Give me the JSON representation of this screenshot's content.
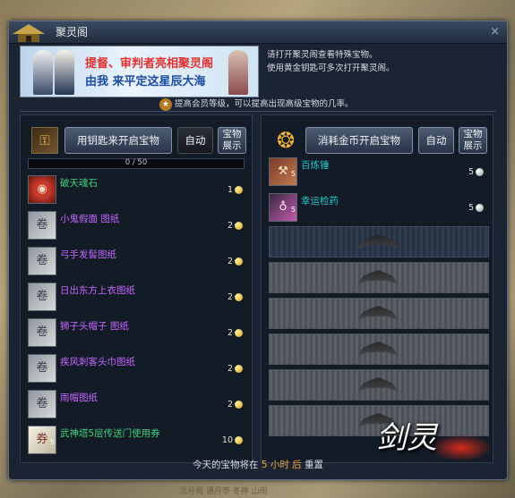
{
  "window": {
    "title": "聚灵阁",
    "close_symbol": "×"
  },
  "banner": {
    "line1": "提督、审判者亮相聚灵阁",
    "line2": "由我 来平定这星辰大海"
  },
  "notice": {
    "line1": "请打开聚灵阁查看特殊宝物。",
    "line2": "使用黄金钥匙可多次打开聚灵阁。"
  },
  "vip_hint": "提高会员等级，可以提高出现高级宝物的几率。",
  "left": {
    "open_button": "用钥匙来开启宝物",
    "auto_button": "自动",
    "showcase_button": [
      "宝物",
      "展示"
    ],
    "progress_text": "0 / 50",
    "progress_value": 0,
    "items": [
      {
        "name": "破天魂石",
        "color": "#43d27b",
        "qty": "1",
        "coin": "gold",
        "icon": "red-orb-icon"
      },
      {
        "name": "小鬼假面 图纸",
        "color": "#c667ff",
        "qty": "2",
        "coin": "gold",
        "icon": "scroll-icon"
      },
      {
        "name": "弓手发髻图纸",
        "color": "#c667ff",
        "qty": "2",
        "coin": "gold",
        "icon": "scroll-icon"
      },
      {
        "name": "日出东方上衣图纸",
        "color": "#c667ff",
        "qty": "2",
        "coin": "gold",
        "icon": "scroll-icon"
      },
      {
        "name": "狮子头帽子 图纸",
        "color": "#c667ff",
        "qty": "2",
        "coin": "gold",
        "icon": "scroll-icon"
      },
      {
        "name": "疾风刺客头巾图纸",
        "color": "#c667ff",
        "qty": "2",
        "coin": "gold",
        "icon": "scroll-icon"
      },
      {
        "name": "雨帽图纸",
        "color": "#c667ff",
        "qty": "2",
        "coin": "gold",
        "icon": "scroll-icon"
      },
      {
        "name": "武神塔5层传送门使用券",
        "color": "#43d27b",
        "qty": "10",
        "coin": "gold",
        "icon": "ticket-icon",
        "sub": "5"
      }
    ]
  },
  "right": {
    "open_button": "消耗金币开启宝物",
    "auto_button": "自动",
    "showcase_button": [
      "宝物",
      "展示"
    ],
    "items": [
      {
        "name": "百炼锤",
        "color": "#27c8c8",
        "qty": "5",
        "coin": "silver",
        "icon": "hammer-icon",
        "sub": "5"
      },
      {
        "name": "幸运检药",
        "color": "#27c8c8",
        "qty": "5",
        "coin": "silver",
        "icon": "potion-icon",
        "sub": "5"
      }
    ],
    "empty_slots": 6
  },
  "footer": {
    "prefix": "今天的宝物将在",
    "highlight": "5 小时 后",
    "suffix": "重置"
  },
  "watermark": "剑灵",
  "taskbar": "流月阁   通月亭   冬神   山雨",
  "colors": {
    "window_bg": "#1b2433",
    "accent_gold": "#f0a840",
    "purple_item": "#c667ff",
    "green_item": "#43d27b",
    "teal_item": "#27c8c8"
  }
}
